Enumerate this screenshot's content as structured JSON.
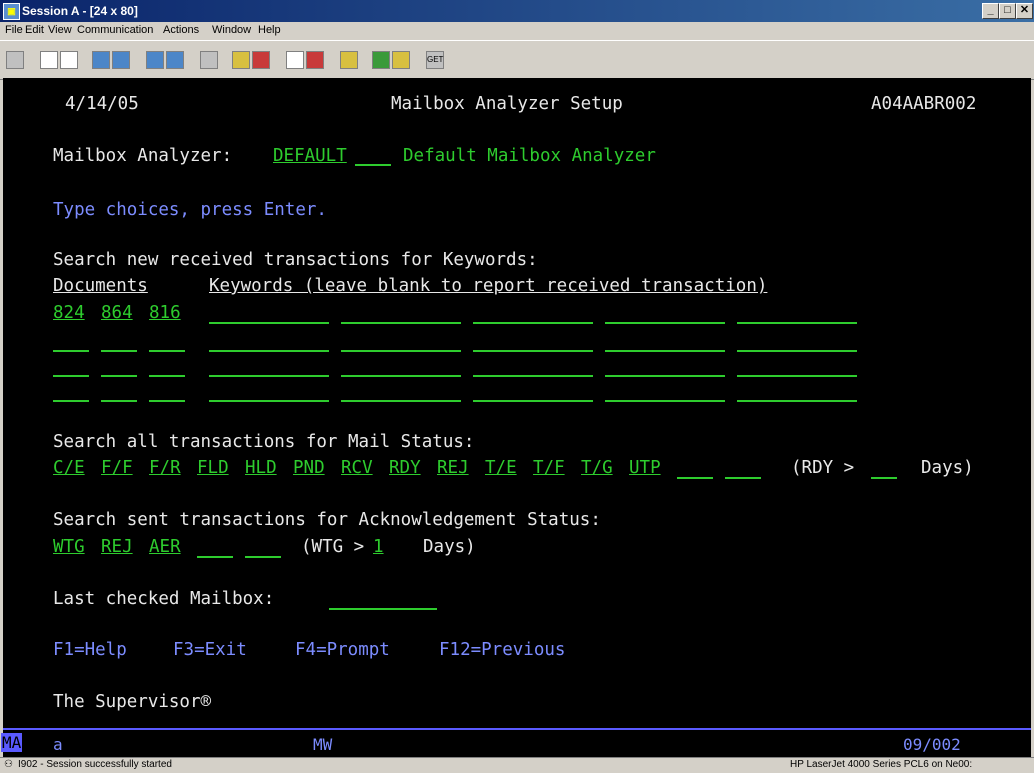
{
  "window": {
    "title": "Session A - [24 x 80]",
    "app_icon_text": "▣",
    "minimize": "_",
    "maximize": "□",
    "close": "✕"
  },
  "menu": [
    "File",
    "Edit",
    "View",
    "Communication",
    "Actions",
    "Window",
    "Help"
  ],
  "toolbar": {
    "get_label": "GET"
  },
  "screen": {
    "date": "4/14/05",
    "title": "Mailbox Analyzer Setup",
    "program": "A04AABR002",
    "analyzer_label": "Mailbox Analyzer:",
    "analyzer_value": "DEFAULT",
    "analyzer_desc": "Default Mailbox Analyzer",
    "instructions": "Type choices, press Enter.",
    "keywords_heading": "Search new received transactions for Keywords:",
    "documents_header": "Documents",
    "keywords_header": "Keywords (leave blank to report received transaction)",
    "documents": [
      "824",
      "864",
      "816"
    ],
    "mail_status_heading": "Search all transactions for Mail Status:",
    "mail_statuses": [
      "C/E",
      "F/F",
      "F/R",
      "FLD",
      "HLD",
      "PND",
      "RCV",
      "RDY",
      "REJ",
      "T/E",
      "T/F",
      "T/G",
      "UTP"
    ],
    "rdy_label": "(RDY >",
    "rdy_days_label": "Days)",
    "ack_heading": "Search sent transactions for Acknowledgement Status:",
    "ack_statuses": [
      "WTG",
      "REJ",
      "AER"
    ],
    "wtg_label": "(WTG >",
    "wtg_days": "1",
    "wtg_days_label": "Days)",
    "last_checked_label": "Last checked Mailbox:",
    "fkeys": [
      "F1=Help",
      "F3=Exit",
      "F4=Prompt",
      "F12=Previous"
    ],
    "footer": "The Supervisor®"
  },
  "oia": {
    "mode": "MA",
    "session": "a",
    "mw": "MW",
    "cursor": "09/002"
  },
  "statusbar": {
    "message": "I902 - Session successfully started",
    "printer": "HP LaserJet 4000 Series PCL6 on Ne00:"
  }
}
